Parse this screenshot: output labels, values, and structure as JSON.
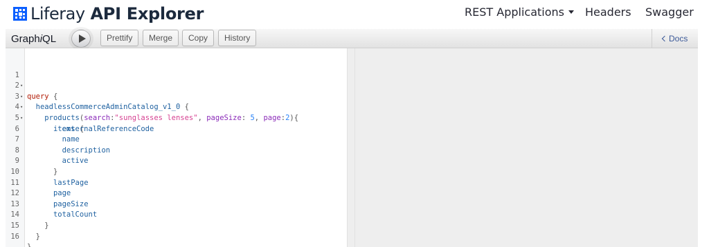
{
  "header": {
    "brand_light": "Liferay",
    "brand_bold": "API Explorer",
    "nav": {
      "rest_applications": "REST Applications",
      "headers": "Headers",
      "swagger": "Swagger"
    }
  },
  "toolbar": {
    "title_prefix": "Graph",
    "title_italic": "i",
    "title_suffix": "QL",
    "buttons": {
      "prettify": "Prettify",
      "merge": "Merge",
      "copy": "Copy",
      "history": "History"
    },
    "docs_label": "Docs"
  },
  "editor": {
    "line_numbers": [
      "1",
      "2",
      "3",
      "4",
      "5",
      "6",
      "7",
      "8",
      "9",
      "10",
      "11",
      "12",
      "13",
      "14",
      "15",
      "16"
    ],
    "folds": [
      "▾",
      "▾",
      "▾",
      "▾"
    ],
    "tokens": {
      "query_kw": "query",
      "open_brace": "{",
      "close_brace": "}",
      "catalog": "headlessCommerceAdminCatalog_v1_0",
      "products": "products",
      "search_arg": "search",
      "search_val": "\"sunglasses lenses\"",
      "pagesize_arg": "pageSize",
      "pagesize_val": "5",
      "page_arg": "page",
      "page_val": "2",
      "items": "items",
      "externalReferenceCode": "externalReferenceCode",
      "name": "name",
      "description": "description",
      "active": "active",
      "lastPage": "lastPage",
      "page": "page",
      "pageSize": "pageSize",
      "totalCount": "totalCount",
      "comma": ",",
      "colon": ":",
      "paren_open": "(",
      "paren_close_brace": "){"
    }
  }
}
